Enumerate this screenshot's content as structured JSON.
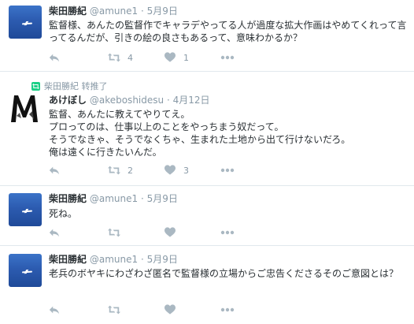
{
  "tweets": [
    {
      "name": "柴田勝紀",
      "handle": "@amune1",
      "separator": "·",
      "date": "5月9日",
      "text": "監督様、あんたの監督作でキャラデやってる人が過度な拡大作画はやめてくれって言ってるんだが、引きの絵の良さもあるって、意味わかるか？",
      "retweets": "4",
      "likes": "1"
    },
    {
      "context": "柴田勝紀 转推了",
      "name": "あけぼし",
      "handle": "@akeboshidesu",
      "separator": "·",
      "date": "4月12日",
      "text": "監督、あんたに教えてやりてえ。\nプロってのは、仕事以上のことをやっちまう奴だって。\nそうでなきゃ、そうでなくちゃ、生まれた土地から出て行けないだろ。\n俺は遠くに行きたいんだ。",
      "retweets": "2",
      "likes": "3"
    },
    {
      "name": "柴田勝紀",
      "handle": "@amune1",
      "separator": "·",
      "date": "5月9日",
      "text": "死ね。"
    },
    {
      "name": "柴田勝紀",
      "handle": "@amune1",
      "separator": "·",
      "date": "5月9日",
      "text": "老兵のボヤキにわざわざ匿名で監督様の立場からご忠告くださるそのご意図とは？"
    }
  ],
  "colors": {
    "text": "#292f33",
    "muted": "#8899a6",
    "icon": "#aab8c2",
    "retweet_green": "#19cf86",
    "divider": "#e1e8ed",
    "avatar_blue": "#2c5bb0"
  },
  "icons": {
    "reply": "reply-icon",
    "retweet": "retweet-icon",
    "like": "heart-icon",
    "more": "more-icon",
    "retweet_context": "retweet-context-icon"
  }
}
